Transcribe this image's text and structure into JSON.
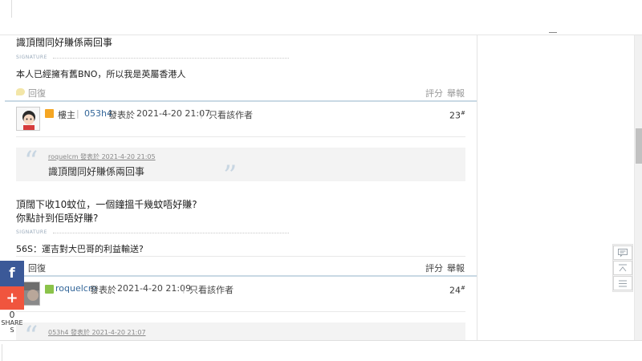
{
  "post22": {
    "message": "識頂闊同好賺係兩回事",
    "signature_label": "SIGNATURE",
    "signature": "本人已經擁有舊BNO，所以我是英屬香港人",
    "reply_label": "回復",
    "rate_label": "評分",
    "report_label": "舉報"
  },
  "post23": {
    "host_label": "樓主",
    "author": "053h4",
    "posted_label": "發表於",
    "datetime": "2021-4-20 21:07",
    "only_author_label": "只看該作者",
    "floor": "23",
    "floor_mark": "#",
    "quote": {
      "author": "roquelcm",
      "posted_label": "發表於",
      "datetime": "2021-4-20 21:05",
      "text": "識頂闊同好賺係兩回事"
    },
    "message_line1": "頂闊下收10蚊位，一個鐘搵千幾蚊唔好賺?",
    "message_line2": "你點計到佢唔好賺?",
    "signature_label": "SIGNATURE",
    "signature": "56S：運吉對大巴哥的利益輸送?",
    "reply_label": "回復",
    "rate_label": "評分",
    "report_label": "舉報"
  },
  "post24": {
    "author": "roquelcm",
    "posted_label": "發表於",
    "datetime": "2021-4-20 21:09",
    "only_author_label": "只看該作者",
    "floor": "24",
    "floor_mark": "#",
    "quote": {
      "author": "053h4",
      "posted_label": "發表於",
      "datetime": "2021-4-20 21:07"
    }
  },
  "share": {
    "facebook_glyph": "f",
    "plus_glyph": "+",
    "count": "0",
    "label": "SHARES"
  },
  "sidetools": {
    "comment_icon": "comment-icon",
    "top_icon": "back-to-top-icon",
    "list_icon": "list-icon"
  },
  "colors": {
    "facebook": "#3b5998",
    "plus": "#f0553e",
    "link": "#336699",
    "divider": "#c9d9e4"
  }
}
